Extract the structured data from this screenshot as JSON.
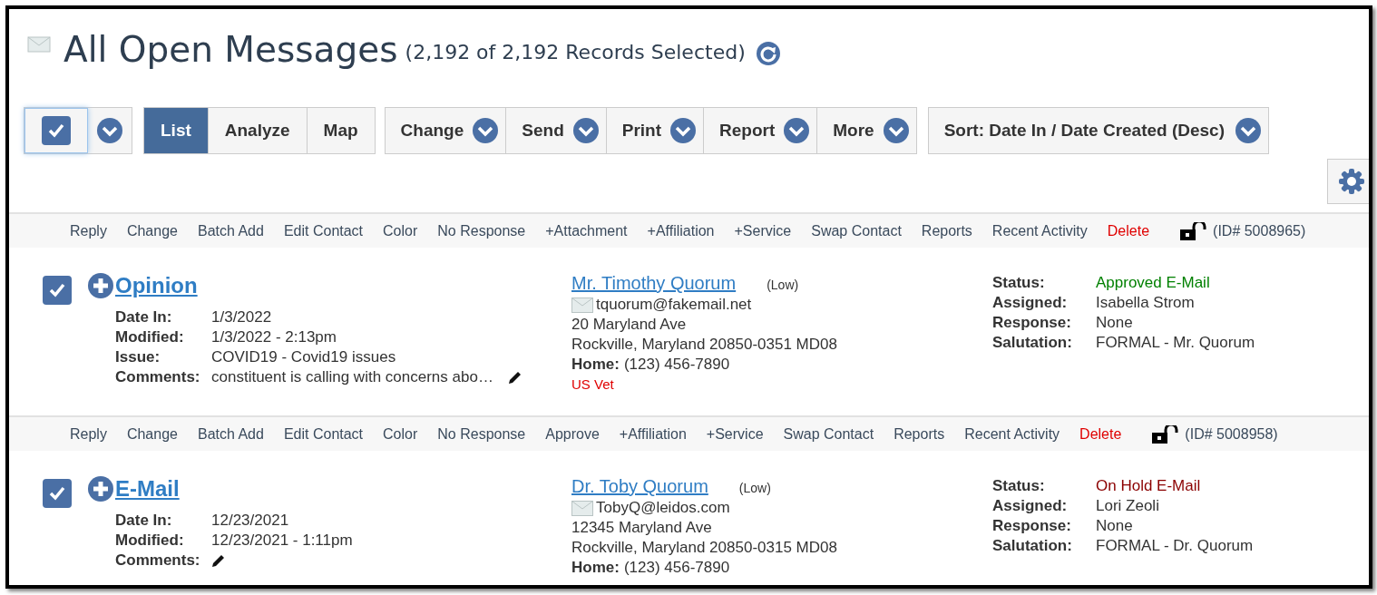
{
  "header": {
    "title": "All Open Messages",
    "count": "(2,192 of 2,192 Records Selected)"
  },
  "toolbar": {
    "select_all": {
      "checked": true
    },
    "view_tabs": [
      {
        "label": "List",
        "selected": true
      },
      {
        "label": "Analyze",
        "selected": false
      },
      {
        "label": "Map",
        "selected": false
      }
    ],
    "menus": [
      "Change",
      "Send",
      "Print",
      "Report",
      "More"
    ],
    "sort": "Sort: Date In / Date Created (Desc)"
  },
  "records": [
    {
      "actions": [
        {
          "label": "Reply",
          "kind": "normal"
        },
        {
          "label": "Change",
          "kind": "normal"
        },
        {
          "label": "Batch Add",
          "kind": "normal"
        },
        {
          "label": "Edit Contact",
          "kind": "normal"
        },
        {
          "label": "Color",
          "kind": "normal"
        },
        {
          "label": "No Response",
          "kind": "normal"
        },
        {
          "label": "+Attachment",
          "kind": "normal"
        },
        {
          "label": "+Affiliation",
          "kind": "normal"
        },
        {
          "label": "+Service",
          "kind": "normal"
        },
        {
          "label": "Swap Contact",
          "kind": "normal"
        },
        {
          "label": "Reports",
          "kind": "normal"
        },
        {
          "label": "Recent Activity",
          "kind": "normal"
        },
        {
          "label": "Delete",
          "kind": "danger"
        }
      ],
      "id": "(ID# 5008965)",
      "checked": true,
      "type": "Opinion",
      "fields": [
        {
          "label": "Date In:",
          "value": "1/3/2022",
          "kind": "text"
        },
        {
          "label": "Modified:",
          "value": "1/3/2022 - 2:13pm",
          "kind": "text"
        },
        {
          "label": "Issue:",
          "value": "COVID19 - Covid19 issues",
          "kind": "text"
        },
        {
          "label": "Comments:",
          "value": "constituent is calling with concerns abo…",
          "kind": "comment"
        }
      ],
      "contact": {
        "name": "Mr. Timothy Quorum",
        "priority": "(Low)",
        "email": "tquorum@fakemail.net",
        "address": [
          "20 Maryland Ave",
          "Rockville, Maryland 20850-0351 MD08"
        ],
        "phone_label": "Home:",
        "phone": "(123) 456-7890",
        "tag": "US Vet"
      },
      "details": [
        {
          "label": "Status:",
          "value": "Approved E-Mail",
          "color": "#008000"
        },
        {
          "label": "Assigned:",
          "value": "Isabella Strom",
          "color": "#333333"
        },
        {
          "label": "Response:",
          "value": "None",
          "color": "#333333"
        },
        {
          "label": "Salutation:",
          "value": "FORMAL - Mr. Quorum",
          "color": "#333333"
        }
      ]
    },
    {
      "actions": [
        {
          "label": "Reply",
          "kind": "normal"
        },
        {
          "label": "Change",
          "kind": "normal"
        },
        {
          "label": "Batch Add",
          "kind": "normal"
        },
        {
          "label": "Edit Contact",
          "kind": "normal"
        },
        {
          "label": "Color",
          "kind": "normal"
        },
        {
          "label": "No Response",
          "kind": "normal"
        },
        {
          "label": "Approve",
          "kind": "normal"
        },
        {
          "label": "+Affiliation",
          "kind": "normal"
        },
        {
          "label": "+Service",
          "kind": "normal"
        },
        {
          "label": "Swap Contact",
          "kind": "normal"
        },
        {
          "label": "Reports",
          "kind": "normal"
        },
        {
          "label": "Recent Activity",
          "kind": "normal"
        },
        {
          "label": "Delete",
          "kind": "danger"
        }
      ],
      "id": "(ID# 5008958)",
      "checked": true,
      "type": "E-Mail",
      "fields": [
        {
          "label": "Date In:",
          "value": "12/23/2021",
          "kind": "text"
        },
        {
          "label": "Modified:",
          "value": "12/23/2021 - 1:11pm",
          "kind": "text"
        },
        {
          "label": "Comments:",
          "kind": "comment"
        }
      ],
      "contact": {
        "name": "Dr. Toby Quorum",
        "priority": "(Low)",
        "email": "TobyQ@leidos.com",
        "address": [
          "12345 Maryland Ave",
          "Rockville, Maryland 20850-0315 MD08"
        ],
        "phone_label": "Home:",
        "phone": "(123) 456-7890"
      },
      "details": [
        {
          "label": "Status:",
          "value": "On Hold E-Mail",
          "color": "#8b0000"
        },
        {
          "label": "Assigned:",
          "value": "Lori Zeoli",
          "color": "#333333"
        },
        {
          "label": "Response:",
          "value": "None",
          "color": "#333333"
        },
        {
          "label": "Salutation:",
          "value": "FORMAL - Dr. Quorum",
          "color": "#333333"
        }
      ]
    }
  ]
}
